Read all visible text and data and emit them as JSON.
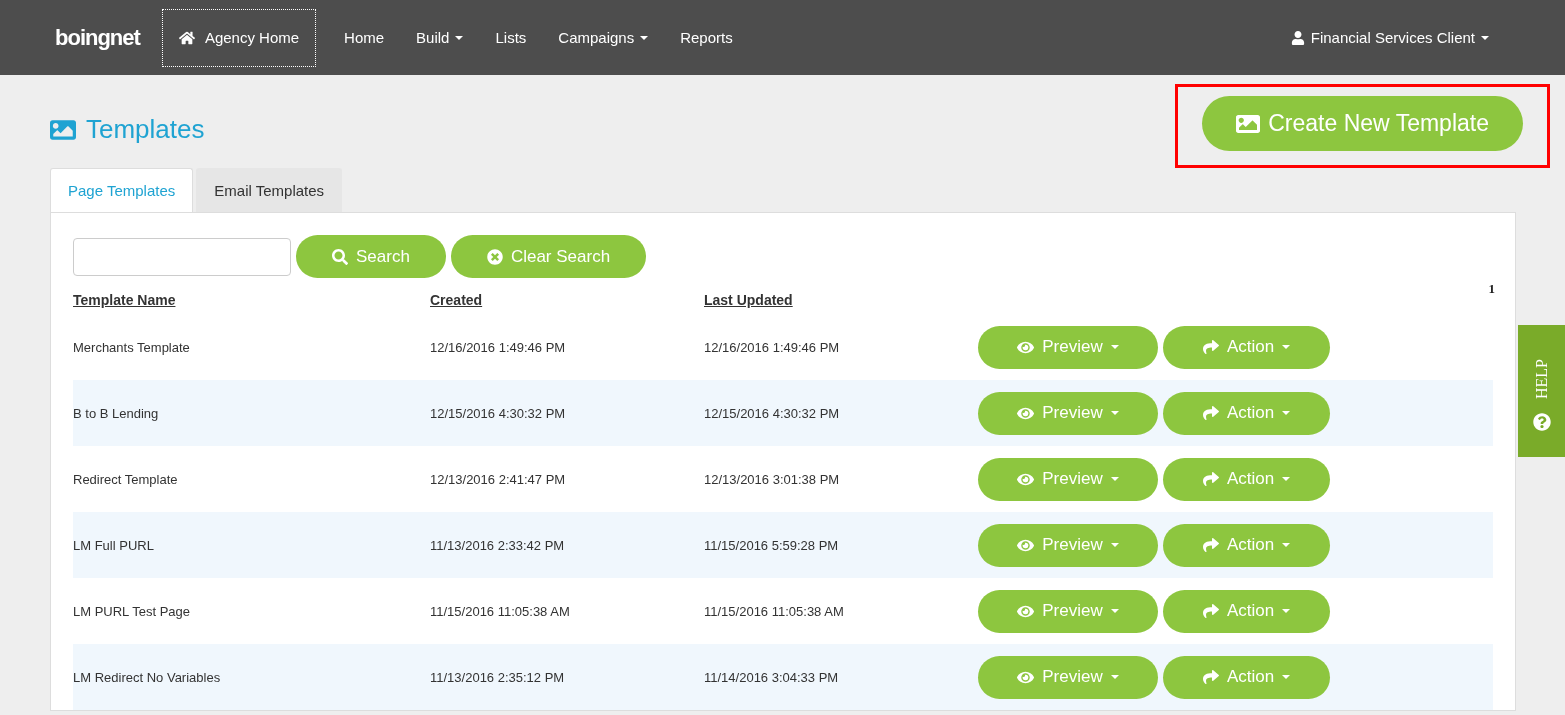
{
  "navbar": {
    "logo": "boingnet",
    "agency_home": "Agency Home",
    "links": [
      {
        "label": "Home",
        "dropdown": false
      },
      {
        "label": "Build",
        "dropdown": true
      },
      {
        "label": "Lists",
        "dropdown": false
      },
      {
        "label": "Campaigns",
        "dropdown": true
      },
      {
        "label": "Reports",
        "dropdown": false
      }
    ],
    "user": "Financial Services Client"
  },
  "page": {
    "title": "Templates",
    "create_button": {
      "label": "Create New Template",
      "highlighted": true
    }
  },
  "tabs": [
    {
      "label": "Page Templates",
      "selected": true
    },
    {
      "label": "Email Templates",
      "selected": false
    }
  ],
  "search": {
    "search_button": "Search",
    "clear_button": "Clear Search"
  },
  "pagination": "1",
  "table": {
    "columns": [
      "Template Name",
      "Created",
      "Last Updated"
    ],
    "rows": [
      {
        "name": "Merchants Template",
        "created": "12/16/2016 1:49:46 PM",
        "updated": "12/16/2016 1:49:46 PM",
        "preview": "Preview",
        "action": "Action"
      },
      {
        "name": "B to B Lending",
        "created": "12/15/2016 4:30:32 PM",
        "updated": "12/15/2016 4:30:32 PM",
        "preview": "Preview",
        "action": "Action"
      },
      {
        "name": "Redirect Template",
        "created": "12/13/2016 2:41:47 PM",
        "updated": "12/13/2016 3:01:38 PM",
        "preview": "Preview",
        "action": "Action"
      },
      {
        "name": "LM Full PURL",
        "created": "11/13/2016 2:33:42 PM",
        "updated": "11/15/2016 5:59:28 PM",
        "preview": "Preview",
        "action": "Action"
      },
      {
        "name": "LM PURL Test Page",
        "created": "11/15/2016 11:05:38 AM",
        "updated": "11/15/2016 11:05:38 AM",
        "preview": "Preview",
        "action": "Action"
      },
      {
        "name": "LM Redirect No Variables",
        "created": "11/13/2016 2:35:12 PM",
        "updated": "11/14/2016 3:04:33 PM",
        "preview": "Preview",
        "action": "Action"
      }
    ]
  },
  "help_tab": "HELP"
}
